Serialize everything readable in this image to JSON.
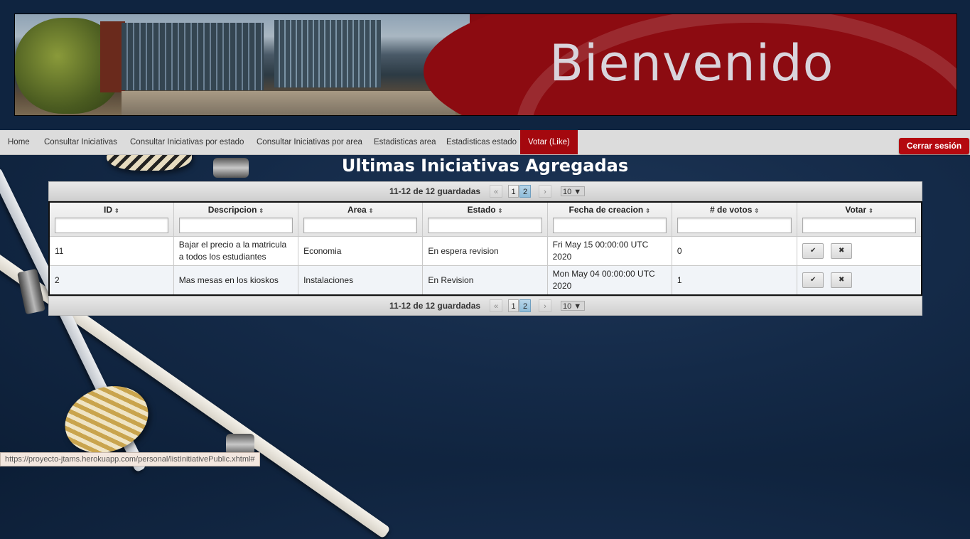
{
  "banner": {
    "title": "Bienvenido"
  },
  "nav": {
    "items": [
      {
        "label": "Home"
      },
      {
        "label": "Consultar Iniciativas"
      },
      {
        "label": "Consultar Iniciativas por estado"
      },
      {
        "label": "Consultar Iniciativas por area"
      },
      {
        "label": "Estadisticas area"
      },
      {
        "label": "Estadisticas estado"
      },
      {
        "label": "Votar (Like)",
        "active": true
      }
    ],
    "logout_label": "Cerrar sesión"
  },
  "page_title": "Ultimas Iniciativas Agregadas",
  "pager": {
    "info": "11-12 de 12 guardadas",
    "pages": [
      "1",
      "2"
    ],
    "current_page": "2",
    "rows_per_page": "10 ▼",
    "first_icon": "«",
    "prev_icon": "‹",
    "next_icon": "›",
    "last_icon": "»"
  },
  "table": {
    "columns": [
      "ID",
      "Descripcion",
      "Area",
      "Estado",
      "Fecha de creacion",
      "# de votos",
      "Votar"
    ],
    "rows": [
      {
        "id": "11",
        "descripcion": "Bajar el precio a la matricula a todos los estudiantes",
        "area": "Economia",
        "estado": "En espera revision",
        "fecha": "Fri May 15 00:00:00 UTC 2020",
        "votos": "0"
      },
      {
        "id": "2",
        "descripcion": "Mas mesas en los kioskos",
        "area": "Instalaciones",
        "estado": "En Revision",
        "fecha": "Mon May 04 00:00:00 UTC 2020",
        "votos": "1"
      }
    ],
    "like_icon": "✔",
    "dislike_icon": "✖",
    "sort_icon": "⇕"
  },
  "status_bar": "https://proyecto-jtams.herokuapp.com/personal/listInitiativePublic.xhtml#"
}
